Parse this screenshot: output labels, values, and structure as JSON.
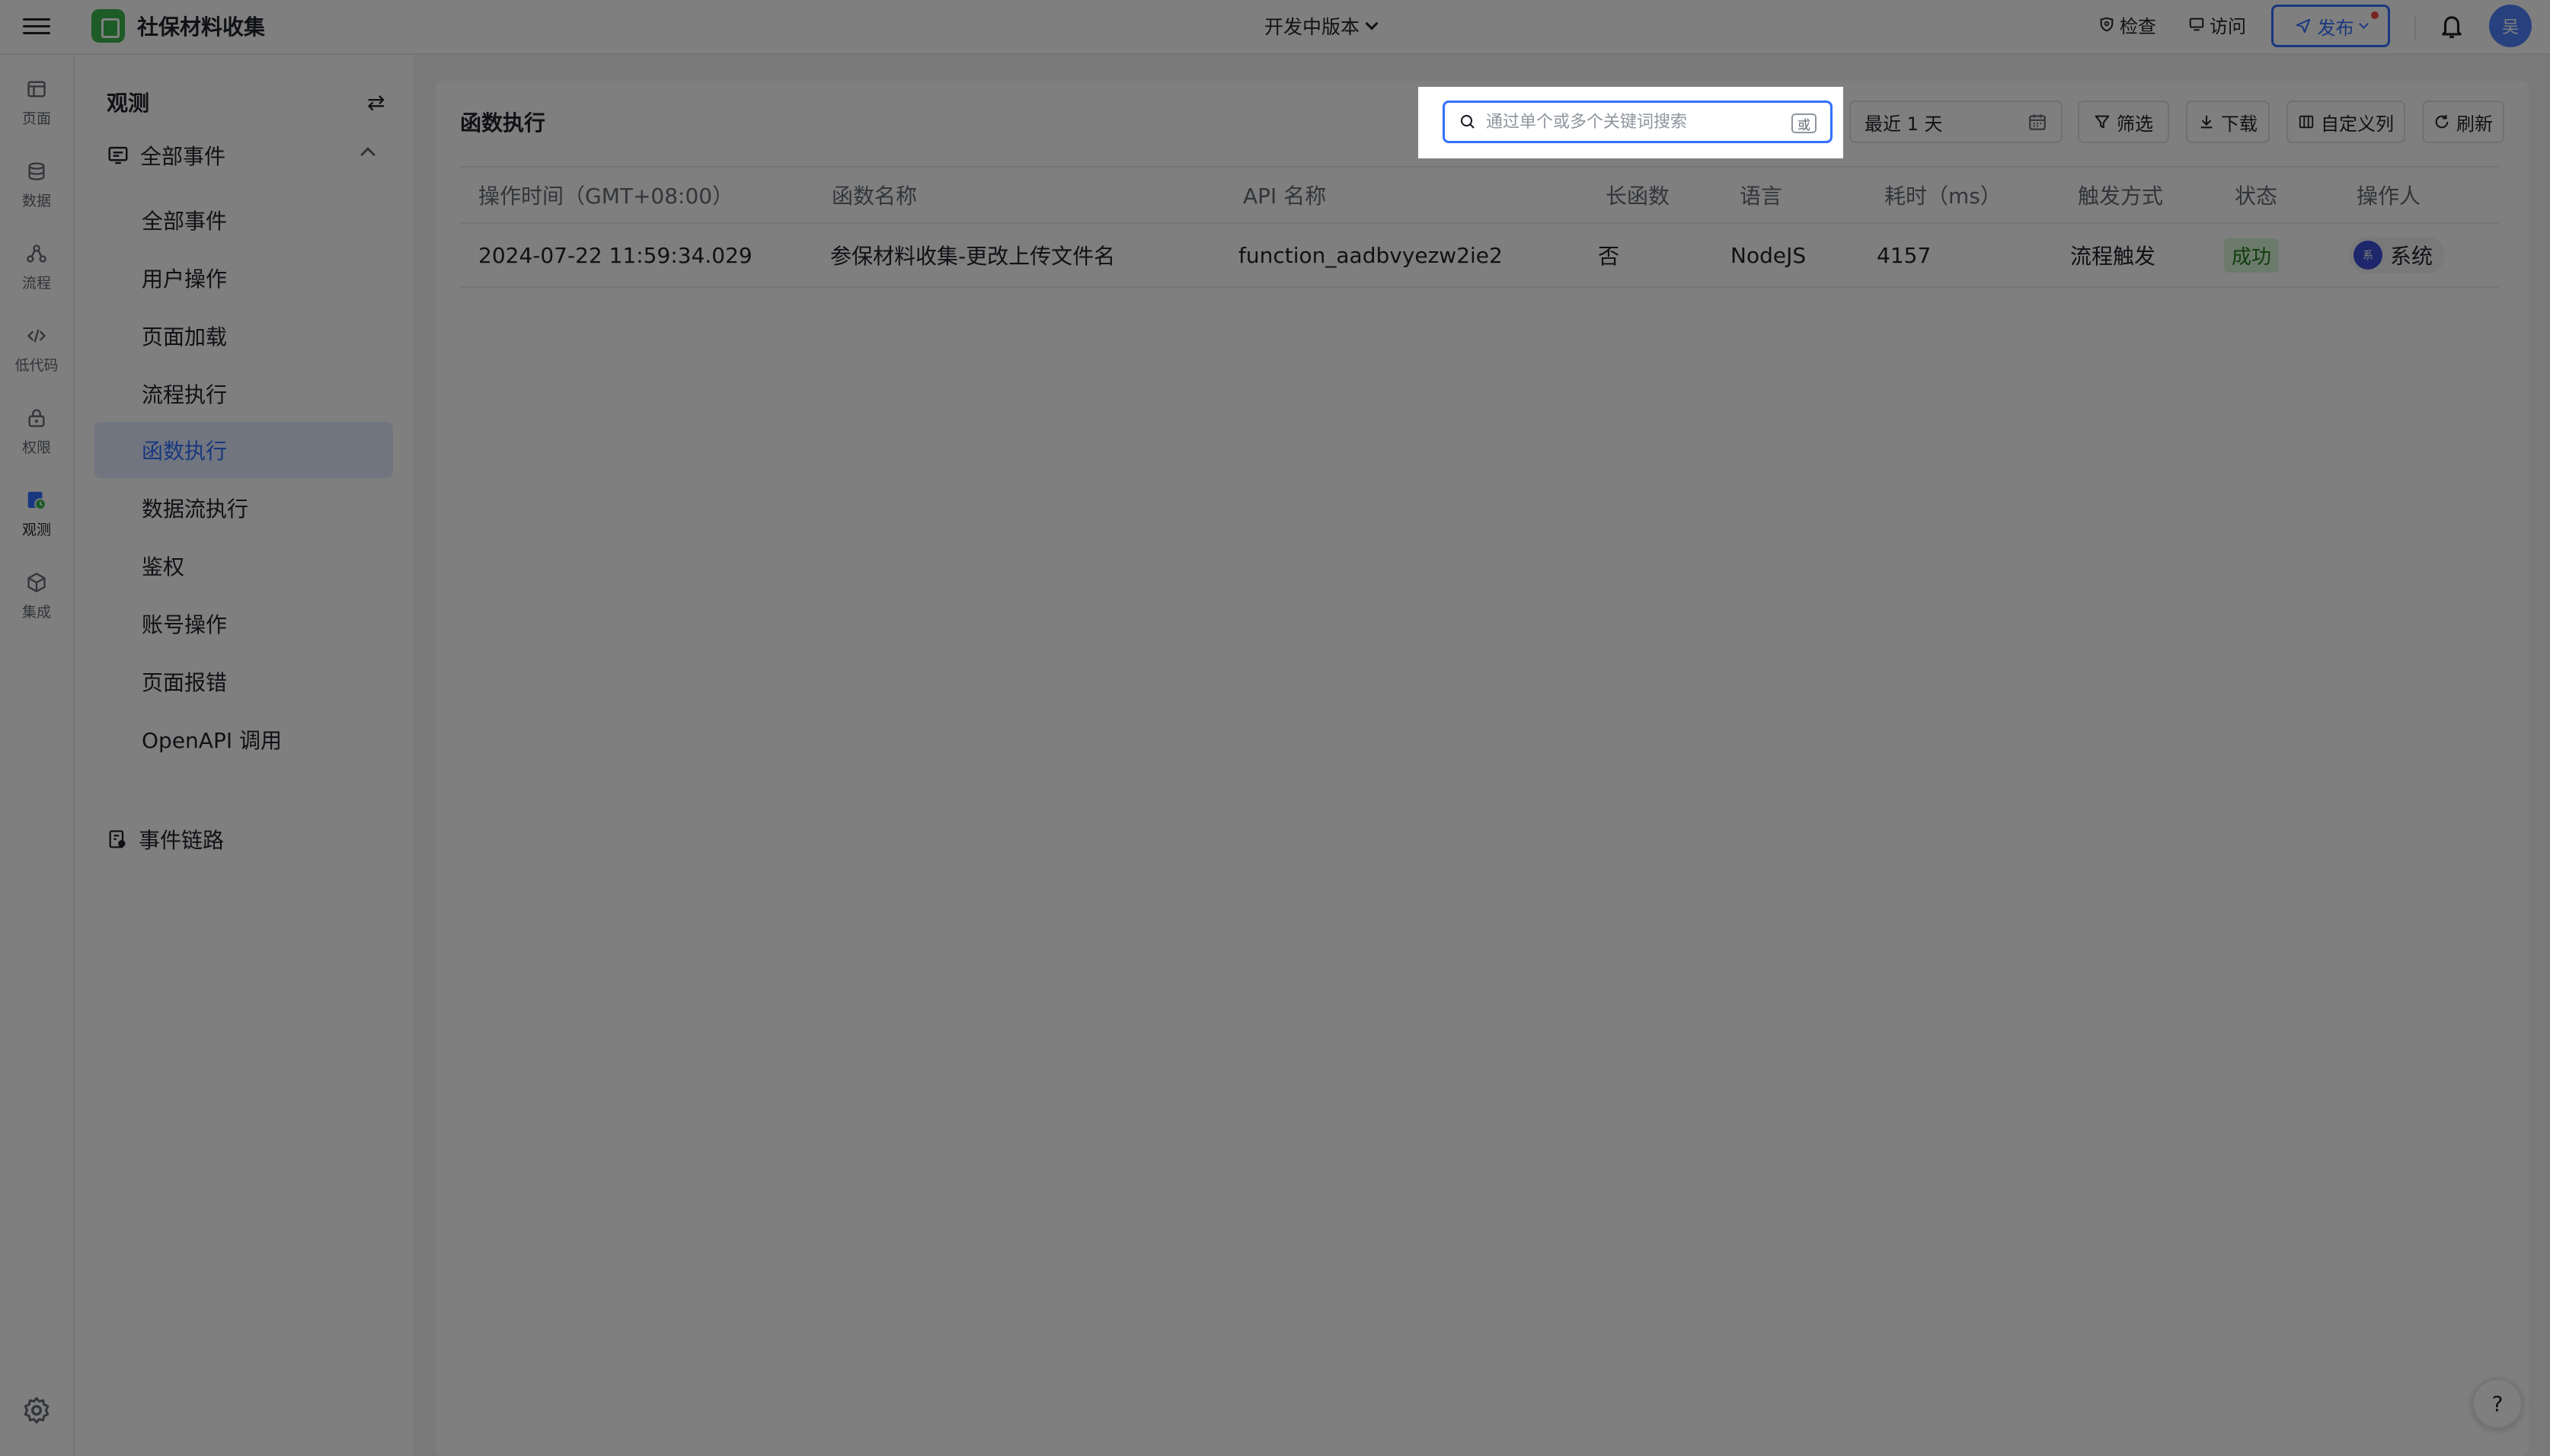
{
  "app": {
    "title": "社保材料收集",
    "avatar_text": "吴"
  },
  "topbar": {
    "version": "开发中版本",
    "inspect_label": "检查",
    "visit_label": "访问",
    "publish_label": "发布"
  },
  "rail": {
    "items": [
      {
        "label": "页面",
        "icon": "page-icon"
      },
      {
        "label": "数据",
        "icon": "database-icon"
      },
      {
        "label": "流程",
        "icon": "flow-icon"
      },
      {
        "label": "低代码",
        "icon": "code-icon"
      },
      {
        "label": "权限",
        "icon": "lock-icon"
      },
      {
        "label": "观测",
        "icon": "observe-icon"
      },
      {
        "label": "集成",
        "icon": "integration-icon"
      }
    ],
    "active": "观测"
  },
  "sidebar": {
    "title": "观测",
    "group_label": "全部事件",
    "items": [
      {
        "label": "全部事件"
      },
      {
        "label": "用户操作"
      },
      {
        "label": "页面加载"
      },
      {
        "label": "流程执行"
      },
      {
        "label": "函数执行"
      },
      {
        "label": "数据流执行"
      },
      {
        "label": "鉴权"
      },
      {
        "label": "账号操作"
      },
      {
        "label": "页面报错"
      },
      {
        "label": "OpenAPI 调用"
      }
    ],
    "active_item": "函数执行",
    "chain_label": "事件链路"
  },
  "main": {
    "title": "函数执行",
    "search": {
      "placeholder": "通过单个或多个关键词搜索",
      "value": "",
      "or_badge": "或"
    },
    "date_range": "最近 1 天",
    "filter_label": "筛选",
    "download_label": "下载",
    "columns_label": "自定义列",
    "refresh_label": "刷新",
    "table": {
      "headers": [
        "操作时间（GMT+08:00）",
        "函数名称",
        "API 名称",
        "长函数",
        "语言",
        "耗时（ms）",
        "触发方式",
        "状态",
        "操作人"
      ],
      "rows": [
        {
          "time": "2024-07-22 11:59:34.029",
          "function_name": "参保材料收集-更改上传文件名",
          "api_name": "function_aadbvyezw2ie2",
          "long_function": "否",
          "language": "NodeJS",
          "duration": "4157",
          "trigger": "流程触发",
          "status": "成功",
          "operator": "系统",
          "operator_avatar": "系"
        }
      ]
    }
  },
  "colors": {
    "accent": "#3370ff",
    "success_bg": "#d9f5d6",
    "success_text": "#237b19",
    "brand_green": "#3bb64f"
  }
}
